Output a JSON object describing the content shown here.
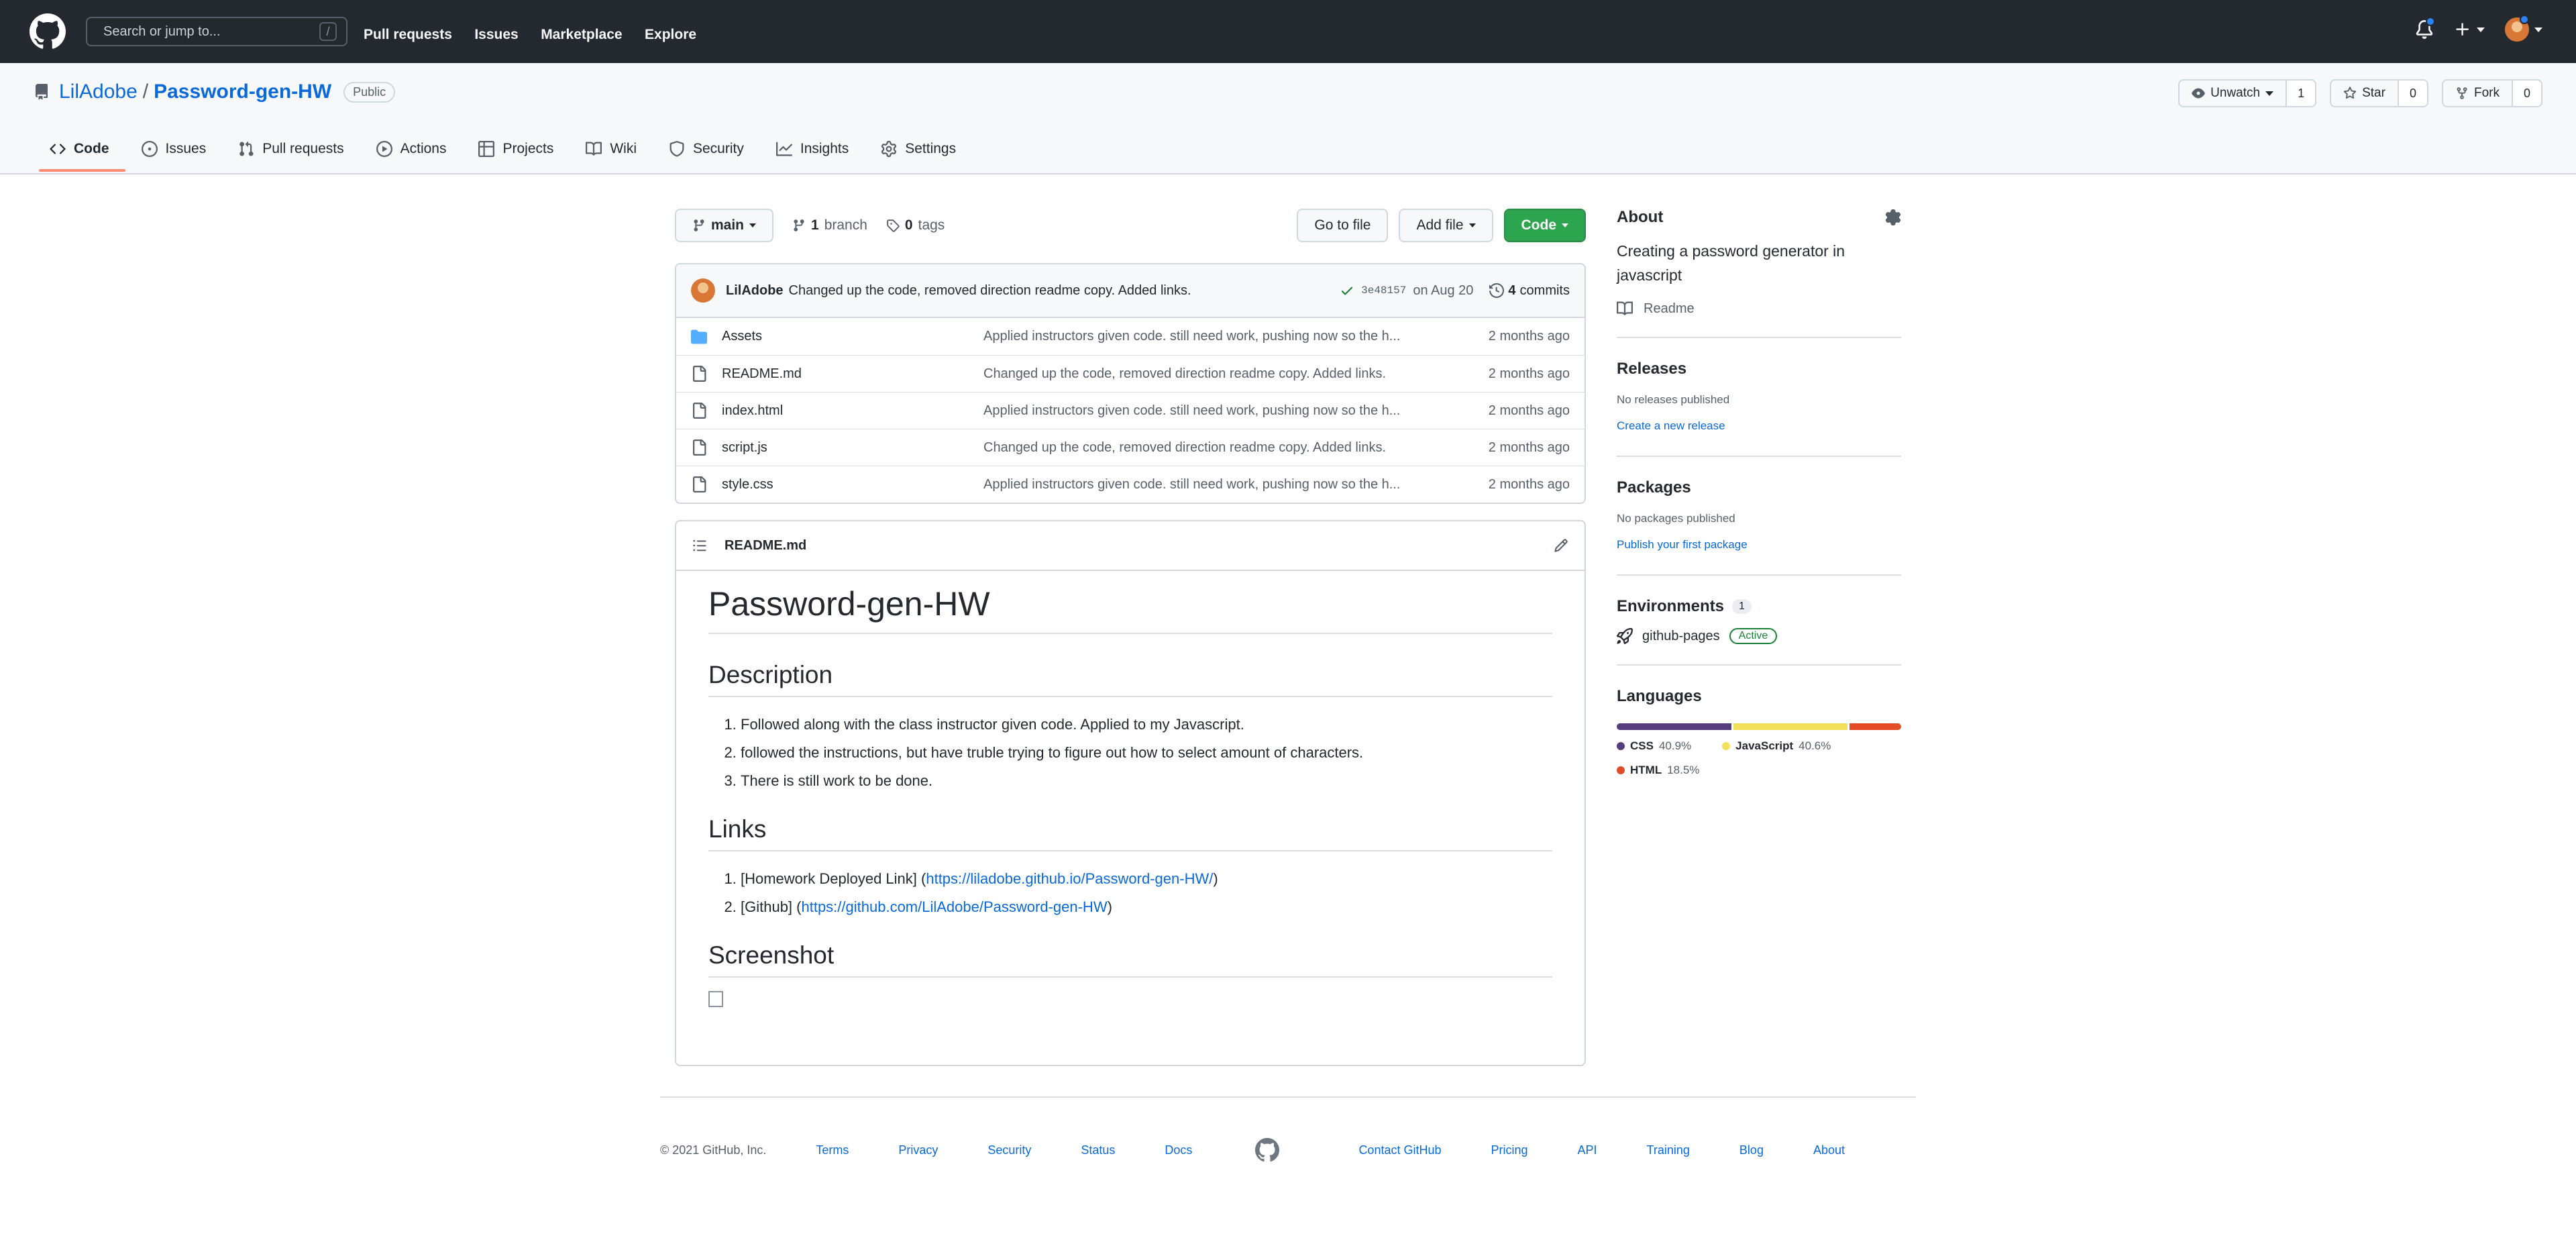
{
  "header": {
    "search_placeholder": "Search or jump to...",
    "search_key": "/",
    "nav": [
      "Pull requests",
      "Issues",
      "Marketplace",
      "Explore"
    ]
  },
  "repo": {
    "owner": "LilAdobe",
    "separator": "/",
    "name": "Password-gen-HW",
    "visibility": "Public",
    "actions": {
      "watch_label": "Unwatch",
      "watch_count": "1",
      "star_label": "Star",
      "star_count": "0",
      "fork_label": "Fork",
      "fork_count": "0"
    },
    "tabs": [
      {
        "label": "Code",
        "icon": "code-icon",
        "active": true
      },
      {
        "label": "Issues",
        "icon": "issue-icon"
      },
      {
        "label": "Pull requests",
        "icon": "pull-request-icon"
      },
      {
        "label": "Actions",
        "icon": "play-icon"
      },
      {
        "label": "Projects",
        "icon": "table-icon"
      },
      {
        "label": "Wiki",
        "icon": "book-icon"
      },
      {
        "label": "Security",
        "icon": "shield-icon"
      },
      {
        "label": "Insights",
        "icon": "graph-icon"
      },
      {
        "label": "Settings",
        "icon": "gear-icon"
      }
    ]
  },
  "branchbar": {
    "branch": "main",
    "branch_count": "1",
    "branch_word": "branch",
    "tag_count": "0",
    "tag_word": "tags",
    "go_to_file": "Go to file",
    "add_file": "Add file",
    "code": "Code"
  },
  "commit": {
    "author": "LilAdobe",
    "message": "Changed up the code, removed direction readme copy. Added links.",
    "sha": "3e48157",
    "date": "on Aug 20",
    "count": "4",
    "count_word": "commits"
  },
  "files": [
    {
      "name": "Assets",
      "type": "folder",
      "message": "Applied instructors given code. still need work, pushing now so the h...",
      "age": "2 months ago"
    },
    {
      "name": "README.md",
      "type": "file",
      "message": "Changed up the code, removed direction readme copy. Added links.",
      "age": "2 months ago"
    },
    {
      "name": "index.html",
      "type": "file",
      "message": "Applied instructors given code. still need work, pushing now so the h...",
      "age": "2 months ago"
    },
    {
      "name": "script.js",
      "type": "file",
      "message": "Changed up the code, removed direction readme copy. Added links.",
      "age": "2 months ago"
    },
    {
      "name": "style.css",
      "type": "file",
      "message": "Applied instructors given code. still need work, pushing now so the h...",
      "age": "2 months ago"
    }
  ],
  "readme": {
    "filename": "README.md",
    "title": "Password-gen-HW",
    "h_description": "Description",
    "description_items": [
      "Followed along with the class instructor given code. Applied to my Javascript.",
      "followed the instructions, but have truble trying to figure out how to select amount of characters.",
      "There is still work to be done."
    ],
    "h_links": "Links",
    "link1_prefix": "[Homework Deployed Link] (",
    "link1_url": "https://liladobe.github.io/Password-gen-HW/",
    "link2_prefix": "[Github] (",
    "link2_url": "https://github.com/LilAdobe/Password-gen-HW",
    "close_paren": ")",
    "h_screenshot": "Screenshot"
  },
  "sidebar": {
    "about_title": "About",
    "about_desc": "Creating a password generator in javascript",
    "readme_label": "Readme",
    "releases_title": "Releases",
    "releases_none": "No releases published",
    "releases_link": "Create a new release",
    "packages_title": "Packages",
    "packages_none": "No packages published",
    "packages_link": "Publish your first package",
    "env_title": "Environments",
    "env_count": "1",
    "env_name": "github-pages",
    "env_status": "Active",
    "languages_title": "Languages",
    "languages": [
      {
        "name": "CSS",
        "pct": "40.9%",
        "value": 40.9,
        "color": "#563d7c"
      },
      {
        "name": "JavaScript",
        "pct": "40.6%",
        "value": 40.6,
        "color": "#f1e05a"
      },
      {
        "name": "HTML",
        "pct": "18.5%",
        "value": 18.5,
        "color": "#e34c26"
      }
    ]
  },
  "footer": {
    "copyright": "© 2021 GitHub, Inc.",
    "left_links": [
      "Terms",
      "Privacy",
      "Security",
      "Status",
      "Docs"
    ],
    "right_links": [
      "Contact GitHub",
      "Pricing",
      "API",
      "Training",
      "Blog",
      "About"
    ]
  }
}
